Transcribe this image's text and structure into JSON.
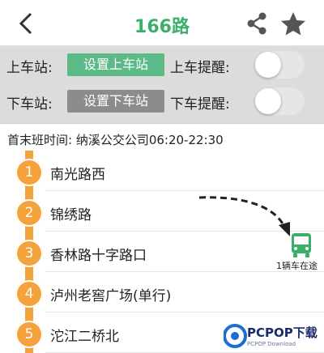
{
  "header": {
    "title": "166路",
    "back_icon": "chevron-left-icon",
    "share_icon": "share-icon",
    "favorite_icon": "star-icon",
    "accent_color": "#3dae6b"
  },
  "stop_settings": {
    "boarding": {
      "label": "上车站:",
      "button_label": "设置上车站",
      "button_color": "#5cba86",
      "reminder_label": "上车提醒:",
      "reminder_on": false
    },
    "alighting": {
      "label": "下车站:",
      "button_label": "设置下车站",
      "button_color": "#8c8c8c",
      "reminder_label": "下车提醒:",
      "reminder_on": false
    }
  },
  "schedule": {
    "text": "首末班时间: 纳溪公交公司06:20-22:30"
  },
  "route": {
    "line_color": "#f4a33c",
    "stops": [
      {
        "number": "1",
        "name": "南光路西"
      },
      {
        "number": "2",
        "name": "锦绣路"
      },
      {
        "number": "3",
        "name": "香林路十字路口"
      },
      {
        "number": "4",
        "name": "泸州老窖广场(单行)"
      },
      {
        "number": "5",
        "name": "沱江二桥北"
      }
    ]
  },
  "bus_indicator": {
    "icon": "bus-icon",
    "status": "1辆车在途",
    "color": "#3dae6b"
  },
  "watermark": {
    "text": "PCPOP下载",
    "subtext": "PCPOP Download"
  }
}
